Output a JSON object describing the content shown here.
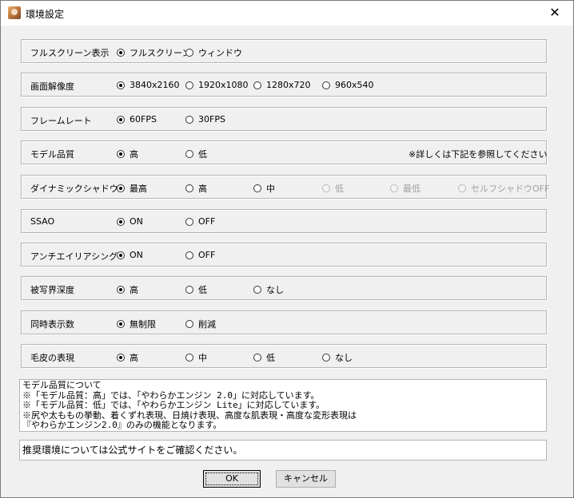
{
  "window": {
    "title": "環境設定",
    "close_glyph": "✕"
  },
  "rows": {
    "fullscreen": {
      "label": "フルスクリーン表示",
      "options": [
        "フルスクリーン",
        "ウィンドウ"
      ]
    },
    "resolution": {
      "label": "画面解像度",
      "options": [
        "3840x2160",
        "1920x1080",
        "1280x720",
        "960x540"
      ]
    },
    "framerate": {
      "label": "フレームレート",
      "options": [
        "60FPS",
        "30FPS"
      ]
    },
    "model_quality": {
      "label": "モデル品質",
      "options": [
        "高",
        "低"
      ],
      "note": "※詳しくは下記を参照してください"
    },
    "dynamic_shadow": {
      "label": "ダイナミックシャドウ",
      "options": [
        "最高",
        "高",
        "中",
        "低",
        "最低",
        "セルフシャドウOFF"
      ]
    },
    "ssao": {
      "label": "SSAO",
      "options": [
        "ON",
        "OFF"
      ]
    },
    "antialiasing": {
      "label": "アンチエイリアシング",
      "options": [
        "ON",
        "OFF"
      ]
    },
    "dof": {
      "label": "被写界深度",
      "options": [
        "高",
        "低",
        "なし"
      ]
    },
    "simultaneous": {
      "label": "同時表示数",
      "options": [
        "無制限",
        "削減"
      ]
    },
    "fur": {
      "label": "毛皮の表現",
      "options": [
        "高",
        "中",
        "低",
        "なし"
      ]
    }
  },
  "info": {
    "lines": [
      "モデル品質について",
      "※「モデル品質：高」では、「やわらかエンジン 2.0」に対応しています。",
      "※「モデル品質：低」では、「やわらかエンジン Lite」に対応しています。",
      "※尻や太ももの挙動、着くずれ表現、日焼け表現、高度な肌表現・高度な変形表現は",
      "『やわらかエンジン2.0』のみの機能となります。"
    ]
  },
  "status": "推奨環境については公式サイトをご確認ください。",
  "buttons": {
    "ok": "OK",
    "cancel": "キャンセル"
  }
}
